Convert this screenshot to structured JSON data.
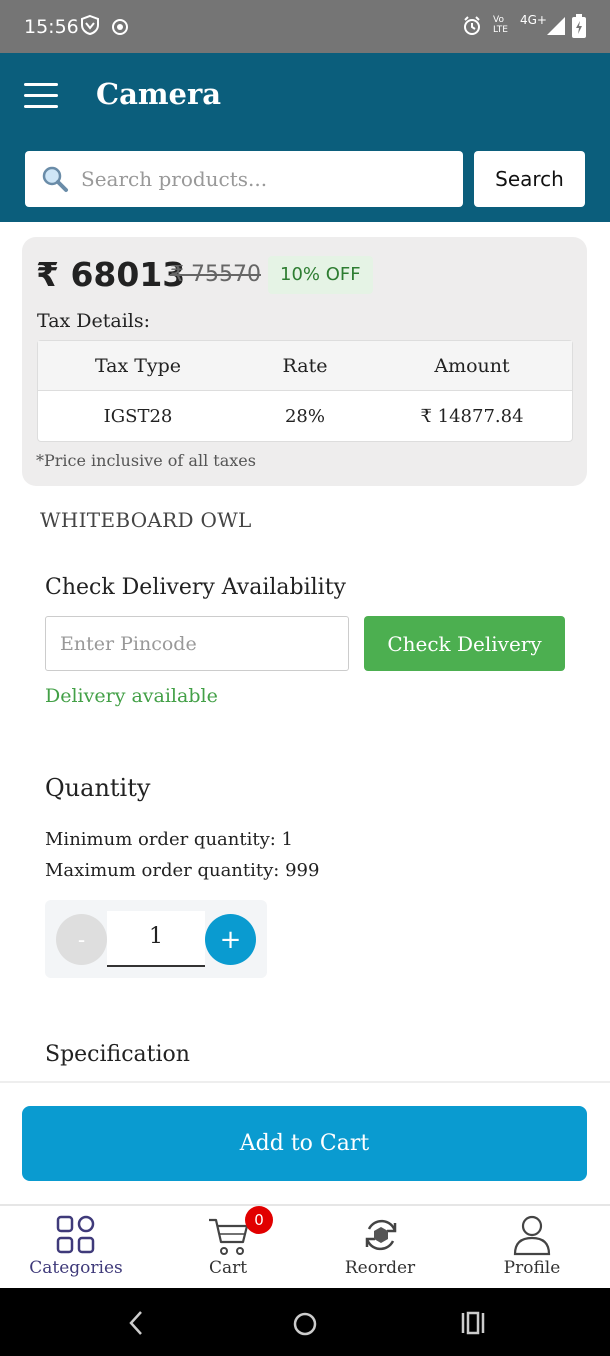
{
  "status_bar": {
    "time": "15:56",
    "network_label": "4G+",
    "volte_label": "Vo LTE"
  },
  "header": {
    "title": "Camera"
  },
  "search": {
    "placeholder": "Search products...",
    "button_label": "Search"
  },
  "price": {
    "current": "₹ 68013",
    "original": "₹ 75570",
    "discount": "10% OFF",
    "tax_label": "Tax Details:",
    "tax_table": {
      "headers": [
        "Tax Type",
        "Rate",
        "Amount"
      ],
      "rows": [
        [
          "IGST28",
          "28%",
          "₹ 14877.84"
        ]
      ]
    },
    "note": "*Price inclusive of all taxes"
  },
  "brand": "WHITEBOARD OWL",
  "delivery": {
    "title": "Check Delivery Availability",
    "pincode_placeholder": "Enter Pincode",
    "button_label": "Check Delivery",
    "status": "Delivery available"
  },
  "quantity": {
    "title": "Quantity",
    "min_text": "Minimum order quantity: 1",
    "max_text": "Maximum order quantity: 999",
    "minus_label": "-",
    "value": "1",
    "plus_label": "+"
  },
  "specification": {
    "title": "Specification"
  },
  "cart_action": {
    "label": "Add to Cart"
  },
  "bottom_nav": {
    "items": [
      {
        "label": "Categories",
        "icon": "grid-icon",
        "active": true
      },
      {
        "label": "Cart",
        "icon": "cart-icon",
        "badge": "0"
      },
      {
        "label": "Reorder",
        "icon": "reorder-icon"
      },
      {
        "label": "Profile",
        "icon": "profile-icon"
      }
    ]
  },
  "colors": {
    "header": "#0b5e7c",
    "primary": "#0a9bd0",
    "success": "#4caf50",
    "active_nav": "#3f3a7a",
    "badge": "#e10000"
  }
}
